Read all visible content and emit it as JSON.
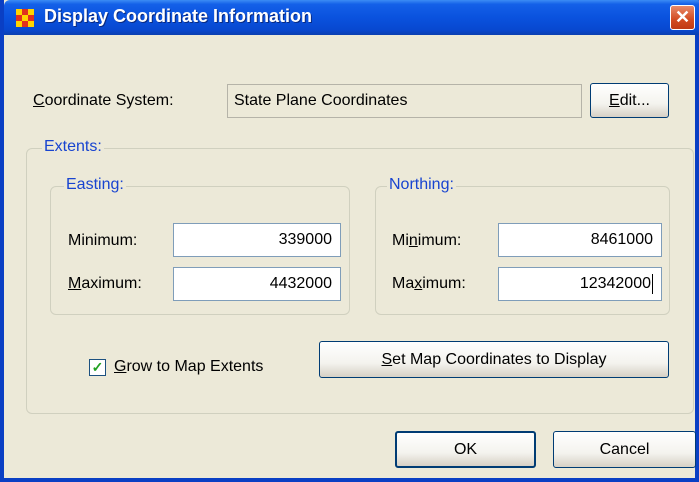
{
  "window": {
    "title": "Display Coordinate Information",
    "close_glyph": "✕"
  },
  "coordinate_system": {
    "label_accel": "C",
    "label_rest": "oordinate System:",
    "value": "State Plane Coordinates",
    "edit_accel": "E",
    "edit_rest": "dit..."
  },
  "extents": {
    "title": "Extents:",
    "easting": {
      "title": "Easting:",
      "min_label": "Minimum:",
      "min_value": "339000",
      "max_label_accel": "M",
      "max_label_rest": "aximum:",
      "max_value": "4432000"
    },
    "northing": {
      "title": "Northing:",
      "min_label_pre": "Mi",
      "min_label_accel": "n",
      "min_label_rest": "imum:",
      "min_value": "8461000",
      "max_label_pre": "Ma",
      "max_label_accel": "x",
      "max_label_rest": "imum:",
      "max_value": "12342000"
    },
    "grow": {
      "checked": true,
      "check_glyph": "✓",
      "label_accel": "G",
      "label_rest": "row to Map Extents"
    },
    "set_map": {
      "label_accel": "S",
      "label_rest": "et Map Coordinates to Display"
    }
  },
  "footer": {
    "ok_label": "OK",
    "cancel_label": "Cancel"
  },
  "colors": {
    "titlebar": "#0a52de",
    "group_title": "#1844d0",
    "face": "#ece9d8"
  }
}
